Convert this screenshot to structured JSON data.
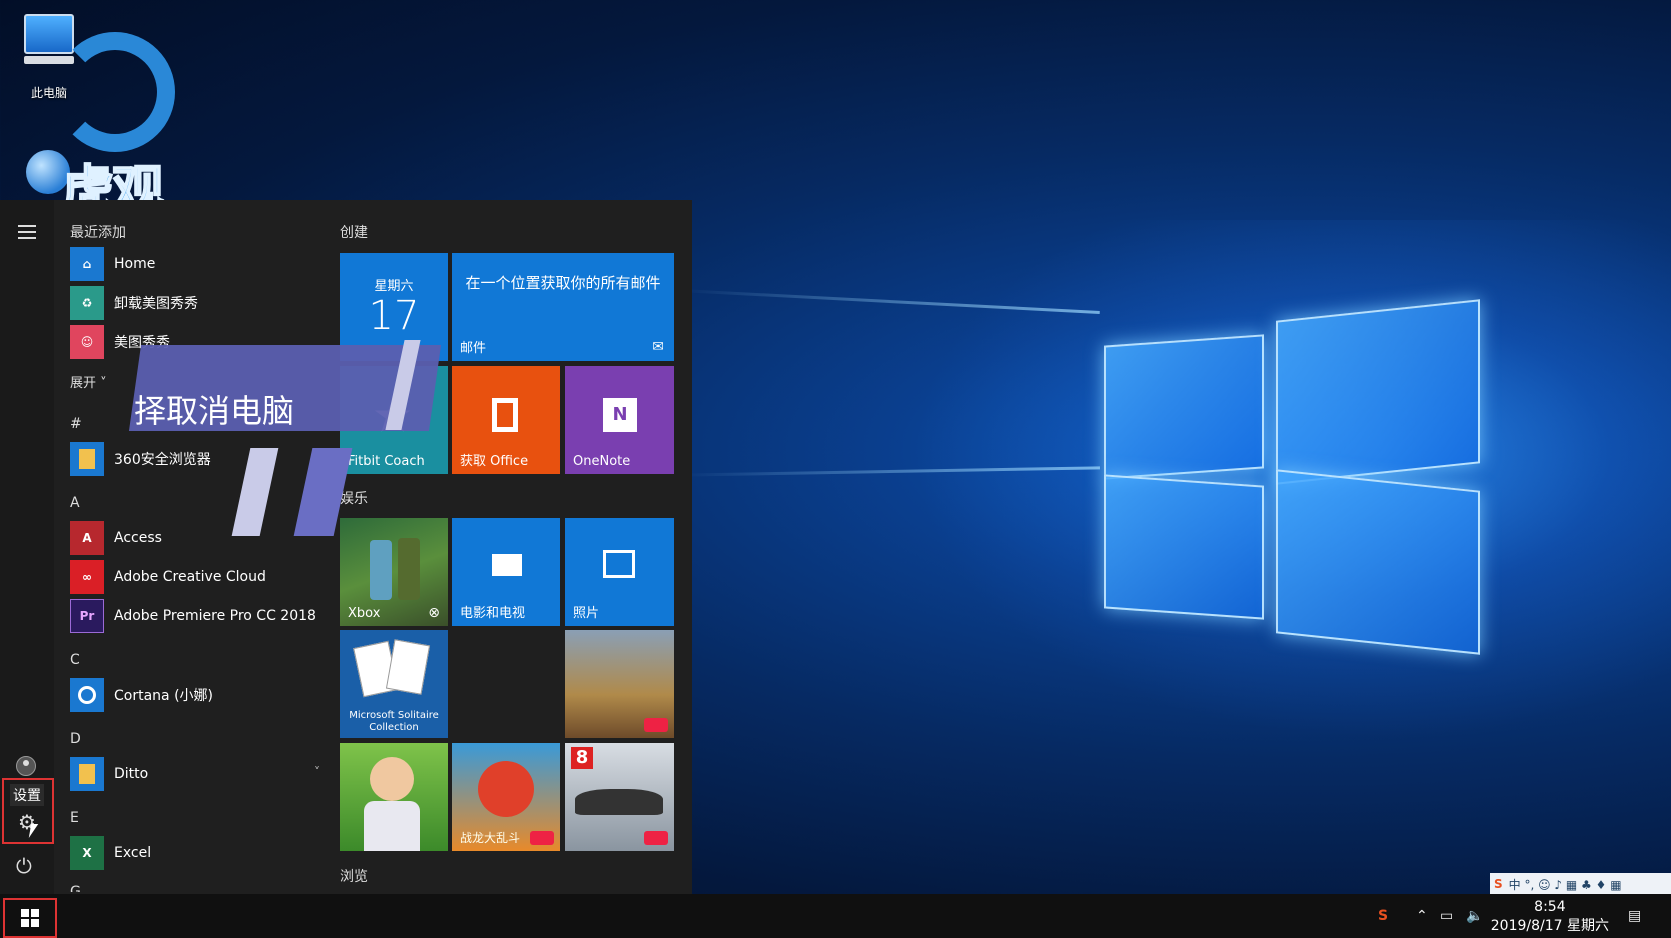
{
  "desktop": {
    "icon_label": "此电脑",
    "watermark_text": "虎观"
  },
  "start_menu": {
    "recent_header": "最近添加",
    "recent_apps": [
      {
        "label": "Home",
        "icon": "home-icon",
        "color": "#1a78d0"
      },
      {
        "label": "卸载美图秀秀",
        "icon": "uninstall-icon",
        "color": "#2a9a8a"
      },
      {
        "label": "美图秀秀",
        "icon": "meitu-icon",
        "color": "#e0455e"
      }
    ],
    "expand_label": "展开",
    "sections": [
      {
        "letter": "#",
        "apps": [
          {
            "label": "360安全浏览器",
            "icon": "folder-icon",
            "color": "#f2c14e",
            "expandable": true
          }
        ]
      },
      {
        "letter": "A",
        "apps": [
          {
            "label": "Access",
            "icon": "access-icon",
            "color": "#b7282e",
            "glyph": "A"
          },
          {
            "label": "Adobe Creative Cloud",
            "icon": "creative-cloud-icon",
            "color": "#da1f26"
          },
          {
            "label": "Adobe Premiere Pro CC 2018",
            "icon": "premiere-icon",
            "color": "#2a1a5e",
            "glyph": "Pr"
          }
        ]
      },
      {
        "letter": "C",
        "apps": [
          {
            "label": "Cortana (小娜)",
            "icon": "cortana-icon",
            "color": "#1a78d0"
          }
        ]
      },
      {
        "letter": "D",
        "apps": [
          {
            "label": "Ditto",
            "icon": "folder-icon",
            "color": "#f2c14e",
            "expandable": true
          }
        ]
      },
      {
        "letter": "E",
        "apps": [
          {
            "label": "Excel",
            "icon": "excel-icon",
            "color": "#1e7145",
            "glyph": "X"
          }
        ]
      }
    ],
    "next_section_letter": "G",
    "settings_tooltip": "设置",
    "banner_text": "择取消电脑"
  },
  "tiles": {
    "group_create": "创建",
    "group_play": "娱乐",
    "group_browse": "浏览",
    "calendar_day": "星期六",
    "calendar_date": "17",
    "mail_text": "在一个位置获取你的所有邮件",
    "mail_label": "邮件",
    "fitbit_label": "Fitbit Coach",
    "office_label": "获取 Office",
    "onenote_label": "OneNote",
    "xbox_label": "Xbox",
    "movies_label": "电影和电视",
    "photos_label": "照片",
    "solitaire_label": "Microsoft Solitaire Collection",
    "dragon_label": "战龙大乱斗",
    "racing_badge": "8"
  },
  "taskbar": {
    "time": "8:54",
    "date": "2019/8/17 星期六",
    "ime_text": "中 °, ☺ ♪ ▦ ♣ ♦ ▦"
  },
  "colors": {
    "tile_blue": "#1178d6",
    "tile_orange": "#e8510f",
    "tile_purple": "#7a3fb0",
    "tile_teal": "#1a8fa0",
    "highlight_red": "#dd3333"
  }
}
